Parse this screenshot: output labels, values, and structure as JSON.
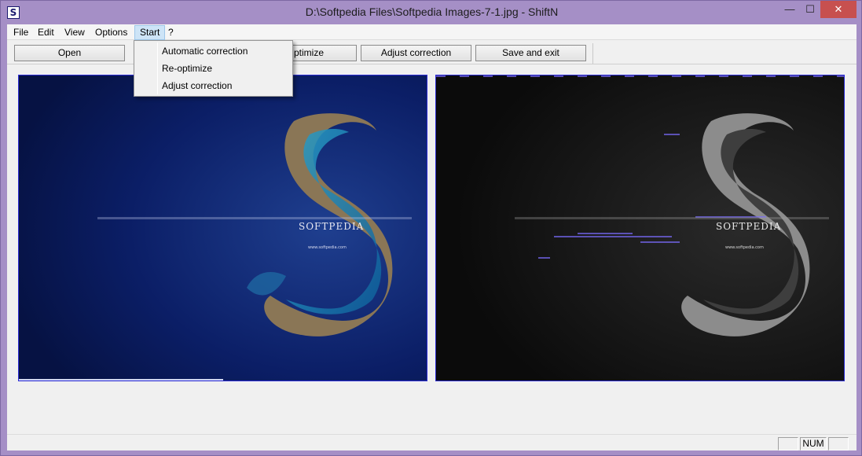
{
  "window": {
    "title": "D:\\Softpedia Files\\Softpedia Images-7-1.jpg - ShiftN",
    "icon_letter": "S",
    "minimize_glyph": "—",
    "maximize_glyph": "☐",
    "close_glyph": "✕"
  },
  "menubar": {
    "items": [
      {
        "label": "File"
      },
      {
        "label": "Edit"
      },
      {
        "label": "View"
      },
      {
        "label": "Options"
      },
      {
        "label": "Start"
      },
      {
        "label": "?"
      }
    ],
    "active": "Start"
  },
  "toolbar": {
    "buttons": [
      {
        "label": "Open"
      },
      {
        "label": "Re-optimize"
      },
      {
        "label": "Adjust correction"
      },
      {
        "label": "Save and exit"
      }
    ],
    "visible_partial_label": "ptimize"
  },
  "start_menu": {
    "items": [
      {
        "label": "Automatic correction"
      },
      {
        "label": "Re-optimize"
      },
      {
        "label": "Adjust correction"
      }
    ]
  },
  "images": {
    "left": {
      "caption": "SOFTPEDIA",
      "url_text": "www.softpedia.com"
    },
    "right": {
      "caption": "SOFTPEDIA",
      "url_text": "www.softpedia.com"
    }
  },
  "statusbar": {
    "cells": [
      "",
      "NUM",
      ""
    ]
  },
  "colors": {
    "frame": "#a58fc6",
    "close_button": "#c7504f",
    "menu_highlight": "#cde4f7",
    "panel_border": "#2b2bd6",
    "left_image_bg": "#0a1a5c",
    "right_image_bg": "#0d0d0d"
  }
}
